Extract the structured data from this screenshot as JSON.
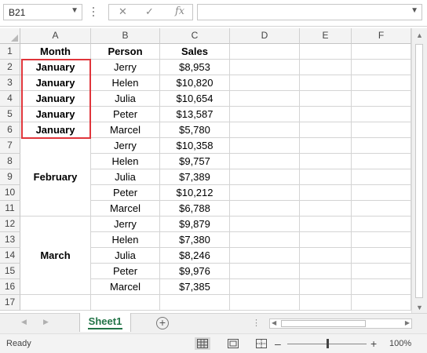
{
  "formula_bar": {
    "name_box": "B21",
    "fx_label": "fx",
    "cancel_icon": "close-icon",
    "enter_icon": "check-icon",
    "formula_value": ""
  },
  "columns": [
    "A",
    "B",
    "C",
    "D",
    "E",
    "F"
  ],
  "rows": [
    "1",
    "2",
    "3",
    "4",
    "5",
    "6",
    "7",
    "8",
    "9",
    "10",
    "11",
    "12",
    "13",
    "14",
    "15",
    "16",
    "17"
  ],
  "headers": {
    "month": "Month",
    "person": "Person",
    "sales": "Sales"
  },
  "months": {
    "r2": "January",
    "r3": "January",
    "r4": "January",
    "r5": "January",
    "r6": "January",
    "february": "February",
    "march": "March"
  },
  "data_rows": [
    {
      "person": "Jerry",
      "sales": "$8,953"
    },
    {
      "person": "Helen",
      "sales": "$10,820"
    },
    {
      "person": "Julia",
      "sales": "$10,654"
    },
    {
      "person": "Peter",
      "sales": "$13,587"
    },
    {
      "person": "Marcel",
      "sales": "$5,780"
    },
    {
      "person": "Jerry",
      "sales": "$10,358"
    },
    {
      "person": "Helen",
      "sales": "$9,757"
    },
    {
      "person": "Julia",
      "sales": "$7,389"
    },
    {
      "person": "Peter",
      "sales": "$10,212"
    },
    {
      "person": "Marcel",
      "sales": "$6,788"
    },
    {
      "person": "Jerry",
      "sales": "$9,879"
    },
    {
      "person": "Helen",
      "sales": "$7,380"
    },
    {
      "person": "Julia",
      "sales": "$8,246"
    },
    {
      "person": "Peter",
      "sales": "$9,976"
    },
    {
      "person": "Marcel",
      "sales": "$7,385"
    }
  ],
  "sheet_tabs": [
    {
      "label": "Sheet1",
      "active": true
    }
  ],
  "status_bar": {
    "ready": "Ready",
    "zoom": "100%"
  },
  "colors": {
    "accent": "#217346",
    "selection_border": "#e0353b",
    "header_bg": "#f3f3f3",
    "gridline": "#d4d4d4"
  }
}
